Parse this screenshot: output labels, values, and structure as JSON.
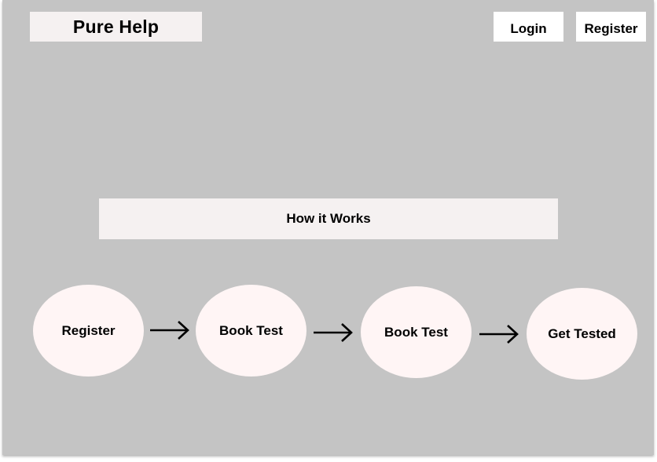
{
  "header": {
    "brand": "Pure Help",
    "login_label": "Login",
    "register_label": "Register"
  },
  "how_it_works": {
    "title": "How it Works",
    "steps": [
      {
        "label": "Register"
      },
      {
        "label": "Book Test"
      },
      {
        "label": "Book Test"
      },
      {
        "label": "Get Tested"
      }
    ]
  },
  "icons": {
    "step_arrow": "arrow-right-icon"
  },
  "colors": {
    "background": "#c4c4c4",
    "panel": "#f5f1f1",
    "button": "#ffffff",
    "step_circle": "#fff5f5",
    "text": "#000000"
  }
}
